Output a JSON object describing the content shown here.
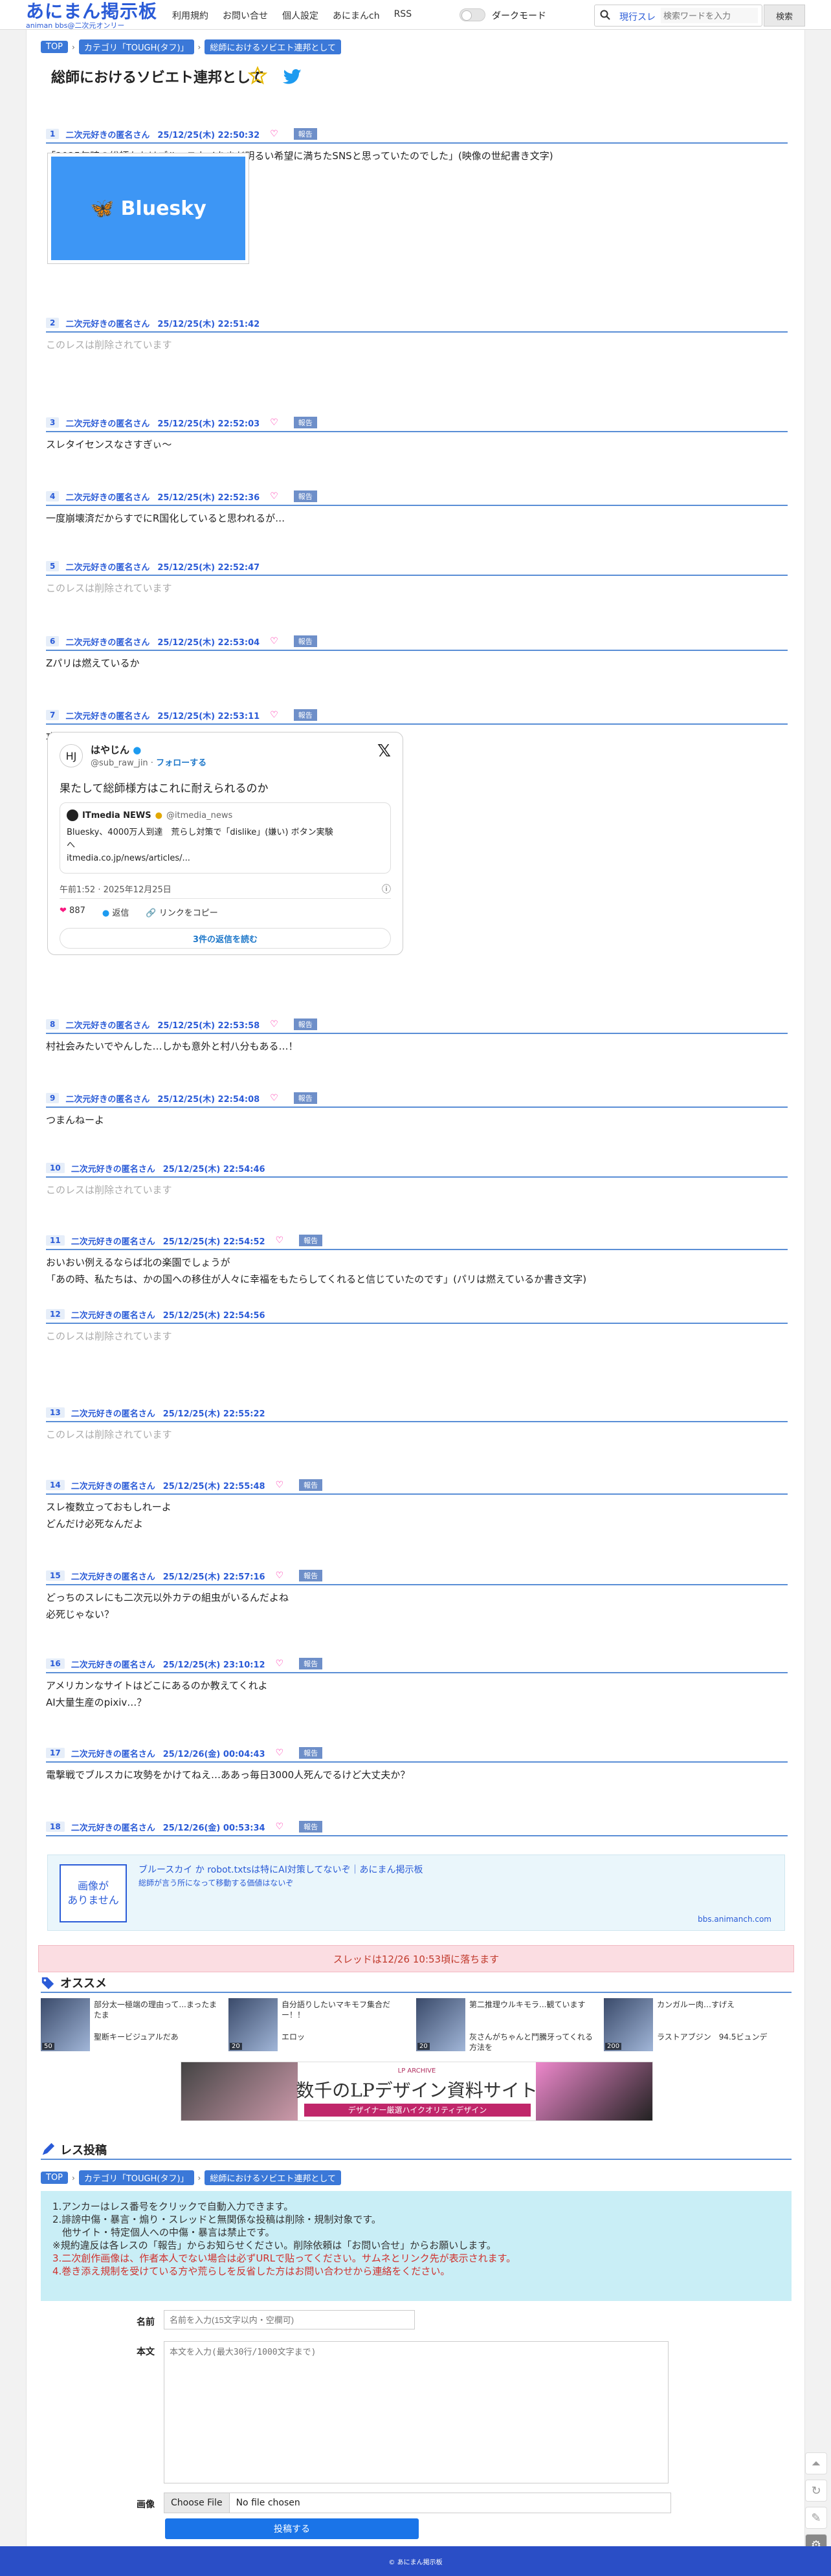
{
  "header": {
    "logo_main": "あにまん掲示板",
    "logo_sub": "animan bbs@二次元オンリー",
    "nav": [
      "利用規約",
      "お問い合せ",
      "個人設定",
      "あにまんch",
      "RSS"
    ],
    "dark_mode_label": "ダークモード",
    "search_scope": "現行スレ",
    "search_placeholder": "検索ワードを入力",
    "search_button": "検索"
  },
  "breadcrumb": [
    "TOP",
    "カテゴリ「TOUGH(タフ)」",
    "総師におけるソビエト連邦として"
  ],
  "thread_title": "総師におけるソビエト連邦として",
  "posts": [
    {
      "num": "1",
      "author": "二次元好きの匿名さん",
      "date": "25/12/25(木) 22:50:32",
      "report": "報告",
      "lines": [
        "「2025年時の総師たちはブルースカイをまだ明るい希望に満ちたSNSと思っていたのでした」(映像の世紀書き文字)"
      ]
    },
    {
      "num": "2",
      "author": "二次元好きの匿名さん",
      "date": "25/12/25(木) 22:51:42",
      "lines": [
        "このレスは削除されています"
      ]
    },
    {
      "num": "3",
      "author": "二次元好きの匿名さん",
      "date": "25/12/25(木) 22:52:03",
      "report": "報告",
      "lines": [
        "スレタイセンスなさすぎぃ〜"
      ]
    },
    {
      "num": "4",
      "author": "二次元好きの匿名さん",
      "date": "25/12/25(木) 22:52:36",
      "report": "報告",
      "lines": [
        "一度崩壊済だからすでにR国化していると思われるが…"
      ]
    },
    {
      "num": "5",
      "author": "二次元好きの匿名さん",
      "date": "25/12/25(木) 22:52:47",
      "lines": [
        "このレスは削除されています"
      ]
    },
    {
      "num": "6",
      "author": "二次元好きの匿名さん",
      "date": "25/12/25(木) 22:53:04",
      "report": "報告",
      "lines": [
        "Zパリは燃えているか"
      ]
    },
    {
      "num": "7",
      "author": "二次元好きの匿名さん",
      "date": "25/12/25(木) 22:53:11",
      "report": "報告",
      "lines": [
        "攻勢を仕掛けたらこれに撃退されそうですね𓏸"
      ]
    },
    {
      "num": "8",
      "author": "二次元好きの匿名さん",
      "date": "25/12/25(木) 22:53:58",
      "report": "報告",
      "lines": [
        "村社会みたいでやんした…しかも意外と村八分もある…！"
      ]
    },
    {
      "num": "9",
      "author": "二次元好きの匿名さん",
      "date": "25/12/25(木) 22:54:08",
      "report": "報告",
      "lines": [
        "つまんねーよ"
      ]
    },
    {
      "num": "10",
      "author": "二次元好きの匿名さん",
      "date": "25/12/25(木) 22:54:46",
      "lines": [
        "このレスは削除されています"
      ]
    },
    {
      "num": "11",
      "author": "二次元好きの匿名さん",
      "date": "25/12/25(木) 22:54:52",
      "report": "報告",
      "lines": [
        "おいおい例えるならば北の楽園でしょうが",
        "「あの時、私たちは、かの国への移住が人々に幸福をもたらしてくれると信じていたのです」(パリは燃えているか書き文字)"
      ]
    },
    {
      "num": "12",
      "author": "二次元好きの匿名さん",
      "date": "25/12/25(木) 22:54:56",
      "lines": [
        "このレスは削除されています"
      ]
    },
    {
      "num": "13",
      "author": "二次元好きの匿名さん",
      "date": "25/12/25(木) 22:55:22",
      "lines": [
        "このレスは削除されています"
      ]
    },
    {
      "num": "14",
      "author": "二次元好きの匿名さん",
      "date": "25/12/25(木) 22:55:48",
      "report": "報告",
      "lines": [
        "スレ複数立っておもしれーよ",
        "どんだけ必死なんだよ"
      ]
    },
    {
      "num": "15",
      "author": "二次元好きの匿名さん",
      "date": "25/12/25(木) 22:57:16",
      "report": "報告",
      "lines": [
        "どっちのスレにも二次元以外カテの組虫がいるんだよね",
        "必死じゃない？"
      ]
    },
    {
      "num": "16",
      "author": "二次元好きの匿名さん",
      "date": "25/12/25(木) 23:10:12",
      "report": "報告",
      "lines": [
        "アメリカンなサイトはどこにあるのか教えてくれよ",
        "AI大量生産のpixiv…？"
      ]
    },
    {
      "num": "17",
      "author": "二次元好きの匿名さん",
      "date": "25/12/26(金) 00:04:43",
      "report": "報告",
      "lines": [
        "電撃戦でブルスカに攻勢をかけてねえ…ああっ毎日3000人死んでるけど大丈夫か？"
      ]
    },
    {
      "num": "18",
      "author": "二次元好きの匿名さん",
      "date": "25/12/26(金) 00:53:34",
      "report": "報告",
      "lines": []
    }
  ],
  "bluesky_image_text": "Bluesky",
  "tweet": {
    "avatar": "HJ",
    "name": "はやじん",
    "handle": "@sub_raw_jin",
    "follow": "フォローする",
    "text": "果たして総師様方はこれに耐えられるのか",
    "quote_name": "ITmedia NEWS",
    "quote_handle": "@itmedia_news",
    "quote_line1": "Bluesky、4000万人到達　荒らし対策で「dislike」(嫌い) ボタン実験",
    "quote_line2": "へ",
    "quote_line3": "itmedia.co.jp/news/articles/...",
    "time": "午前1:52 · 2025年12月25日",
    "likes": "887",
    "reply": "返信",
    "copy": "リンクをコピー",
    "read_replies": "3件の返信を読む"
  },
  "link_card": {
    "no_image": "画像が\nありません",
    "title": "ブルースカイ か robot.txtsは特にAI対策してないぞ｜あにまん掲示板",
    "desc": "総師が言う所になって移動する価値はないぞ",
    "domain": "bbs.animanch.com"
  },
  "notice": "スレッドは12/26 10:53頃に落ちます",
  "recommend_title": "オススメ",
  "recommend": [
    {
      "t1": "部分太一極端の理由って...まったまたま",
      "t2": "聖断キービジュアルだあ",
      "count": "50"
    },
    {
      "t1": "自分語りしたいマキモフ集合だー！！",
      "t2": "エロッ",
      "count": "20"
    },
    {
      "t1": "第二推理ウルキモラ...観ています",
      "t2": "灰さんがちゃんと鬥騰牙ってくれる方法を",
      "count": "20"
    },
    {
      "t1": "カンガルー肉…すげえ",
      "t2": "ラストアブジン　94.5ビュンデ",
      "count": "200"
    }
  ],
  "banner": {
    "small": "LP ARCHIVE",
    "title": "数千のLPデザイン資料サイト",
    "sub": "デザイナー厳選ハイクオリティデザイン"
  },
  "post_section_title": "レス投稿",
  "rules": [
    "1.アンカーはレス番号をクリックで自動入力できます。",
    "2.誹謗中傷・暴言・煽り・スレッドと無関係な投稿は削除・規制対象です。",
    "　他サイト・特定個人への中傷・暴言は禁止です。",
    "※規約違反は各レスの「報告」からお知らせください。削除依頼は「お問い合せ」からお願いします。",
    "3.二次創作画像は、作者本人でない場合は必ずURLで貼ってください。サムネとリンク先が表示されます。",
    "4.巻き添え規制を受けている方や荒らしを反省した方はお問い合わせから連絡をください。"
  ],
  "form": {
    "name_label": "名前",
    "name_placeholder": "名前を入力(15文字以内・空欄可)",
    "body_label": "本文",
    "body_placeholder": "本文を入力(最大30行/1000文字まで)",
    "image_label": "画像",
    "choose_file": "Choose File",
    "no_file": "No file chosen",
    "submit": "投稿する"
  },
  "footer": "© あにまん掲示板"
}
